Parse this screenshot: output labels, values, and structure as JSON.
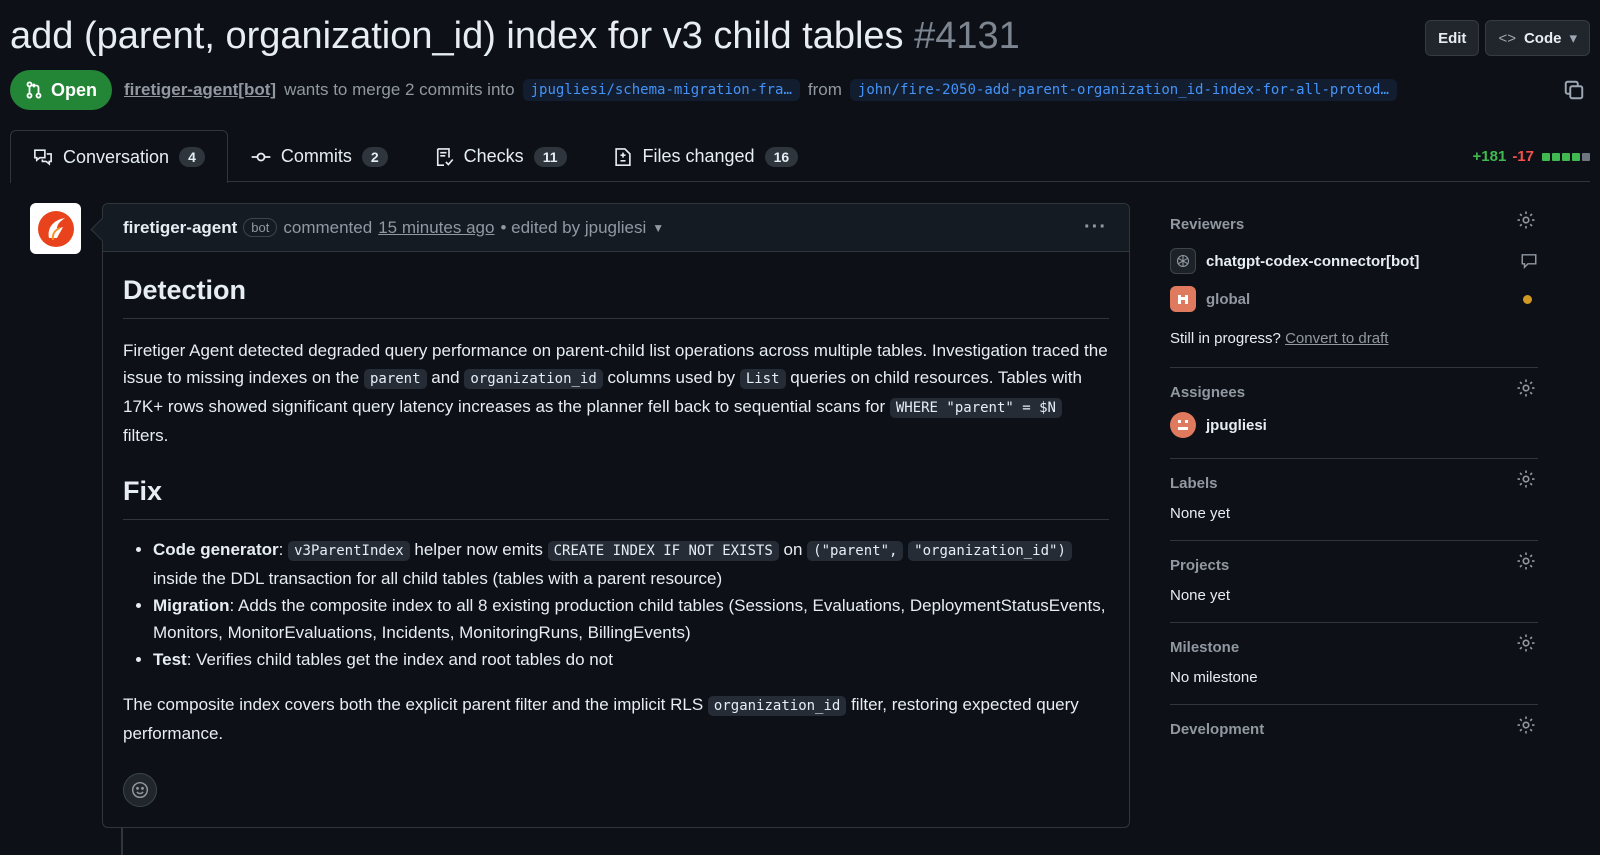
{
  "header": {
    "title": "add (parent, organization_id) index for v3 child tables",
    "number": "#4131",
    "edit_label": "Edit",
    "code_label": "Code"
  },
  "meta": {
    "state": "Open",
    "author": "firetiger-agent[bot]",
    "merge_text": "wants to merge 2 commits into",
    "base_branch": "jpugliesi/schema-migration-fra…",
    "from_text": "from",
    "head_branch": "john/fire-2050-add-parent-organization_id-index-for-all-protod…"
  },
  "tabs": [
    {
      "label": "Conversation",
      "count": "4"
    },
    {
      "label": "Commits",
      "count": "2"
    },
    {
      "label": "Checks",
      "count": "11"
    },
    {
      "label": "Files changed",
      "count": "16"
    }
  ],
  "diffstat": {
    "additions": "+181",
    "deletions": "-17",
    "green_blocks": 4,
    "total_blocks": 5
  },
  "comment": {
    "author": "firetiger-agent",
    "bot_label": "bot",
    "action": "commented",
    "time": "15 minutes ago",
    "edited": "• edited by jpugliesi",
    "detection_heading": "Detection",
    "detection_p": {
      "t1": "Firetiger Agent detected degraded query performance on parent-child list operations across multiple tables. Investigation traced the issue to missing indexes on the ",
      "c1": "parent",
      "t2": " and ",
      "c2": "organization_id",
      "t3": " columns used by ",
      "c3": "List",
      "t4": " queries on child resources. Tables with 17K+ rows showed significant query latency increases as the planner fell back to sequential scans for ",
      "c4": "WHERE \"parent\" = $N",
      "t5": " filters."
    },
    "fix_heading": "Fix",
    "fix_items": {
      "i1_label": "Code generator",
      "i1_sep": ": ",
      "i1_c1": "v3ParentIndex",
      "i1_t1": " helper now emits ",
      "i1_c2": "CREATE INDEX IF NOT EXISTS",
      "i1_t2": " on ",
      "i1_c3": "(\"parent\",",
      "i1_c4": "\"organization_id\")",
      "i1_t3": " inside the DDL transaction for all child tables (tables with a parent resource)",
      "i2_label": "Migration",
      "i2_text": ": Adds the composite index to all 8 existing production child tables (Sessions, Evaluations, DeploymentStatusEvents, Monitors, MonitorEvaluations, Incidents, MonitoringRuns, BillingEvents)",
      "i3_label": "Test",
      "i3_text": ": Verifies child tables get the index and root tables do not"
    },
    "closing": {
      "t1": "The composite index covers both the explicit parent filter and the implicit RLS ",
      "c1": "organization_id",
      "t2": " filter, restoring expected query performance."
    }
  },
  "sidebar": {
    "reviewers_heading": "Reviewers",
    "reviewers": [
      {
        "name": "chatgpt-codex-connector[bot]"
      },
      {
        "name": "global"
      }
    ],
    "still_in_progress": "Still in progress?",
    "convert_to_draft": "Convert to draft",
    "assignees_heading": "Assignees",
    "assignee": "jpugliesi",
    "labels_heading": "Labels",
    "labels_value": "None yet",
    "projects_heading": "Projects",
    "projects_value": "None yet",
    "milestone_heading": "Milestone",
    "milestone_value": "No milestone",
    "development_heading": "Development"
  },
  "colors": {
    "open_green": "#238636",
    "accent_blue": "#4493f8",
    "additions": "#3fb950",
    "deletions": "#f85149",
    "pending": "#d29922"
  }
}
